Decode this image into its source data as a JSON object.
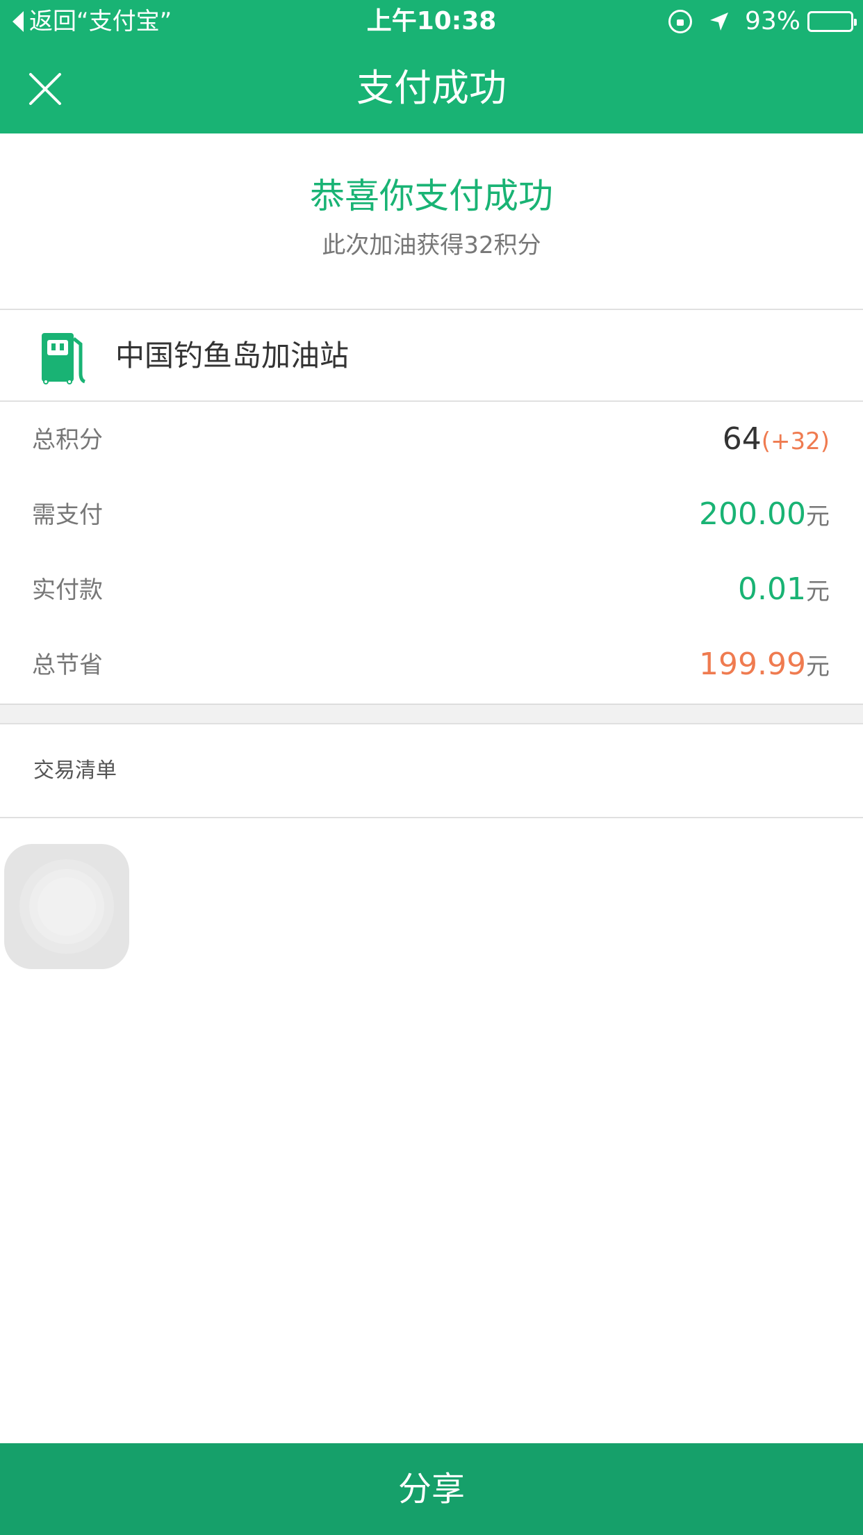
{
  "status_bar": {
    "back_label": "返回“支付宝”",
    "time": "上午10:38",
    "battery_percent": "93%",
    "battery_level": 0.93
  },
  "nav": {
    "title": "支付成功"
  },
  "success": {
    "title": "恭喜你支付成功",
    "subtitle": "此次加油获得32积分"
  },
  "station": {
    "name": "中国钓鱼岛加油站",
    "icon": "fuel-pump-icon"
  },
  "details": {
    "total_points": {
      "label": "总积分",
      "value": "64",
      "delta": "(+32)"
    },
    "amount_due": {
      "label": "需支付",
      "value": "200.00",
      "unit": "元"
    },
    "actual_paid": {
      "label": "实付款",
      "value": "0.01",
      "unit": "元"
    },
    "total_saved": {
      "label": "总节省",
      "value": "199.99",
      "unit": "元"
    }
  },
  "transaction_list": {
    "label": "交易清单"
  },
  "share": {
    "label": "分享"
  },
  "colors": {
    "brand_green": "#19b374",
    "button_green": "#16a06a",
    "accent_orange": "#ef7b50"
  }
}
